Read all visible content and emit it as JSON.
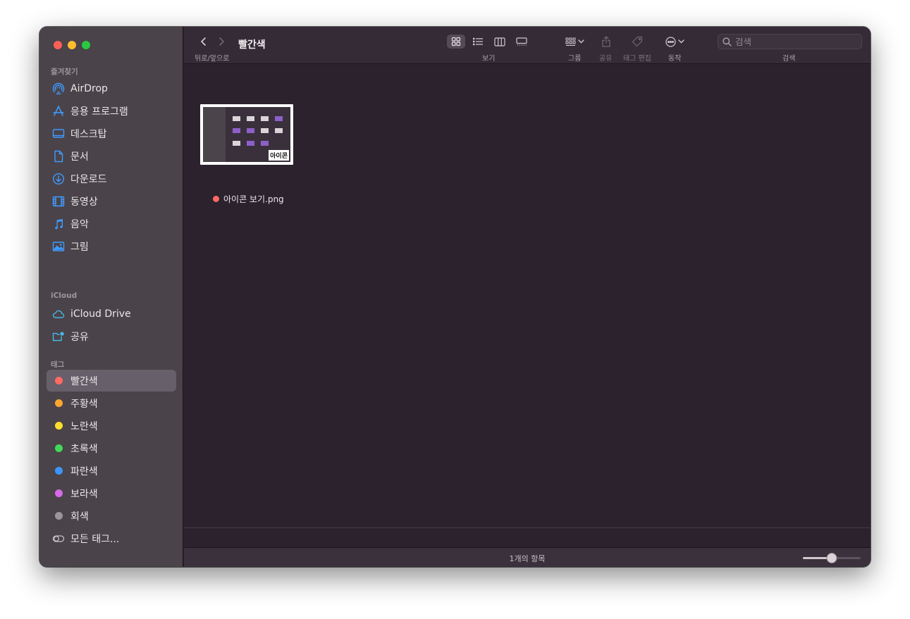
{
  "sidebar": {
    "favorites_title": "즐겨찾기",
    "favorites": [
      {
        "label": "AirDrop",
        "icon": "airdrop-icon"
      },
      {
        "label": "응용 프로그램",
        "icon": "applications-icon"
      },
      {
        "label": "데스크탑",
        "icon": "desktop-icon"
      },
      {
        "label": "문서",
        "icon": "document-icon"
      },
      {
        "label": "다운로드",
        "icon": "download-icon"
      },
      {
        "label": "동영상",
        "icon": "movie-icon"
      },
      {
        "label": "음악",
        "icon": "music-icon"
      },
      {
        "label": "그림",
        "icon": "picture-icon"
      }
    ],
    "icloud_title": "iCloud",
    "icloud": [
      {
        "label": "iCloud Drive",
        "icon": "cloud-icon"
      },
      {
        "label": "공유",
        "icon": "shared-folder-icon"
      }
    ],
    "tags_title": "태그",
    "tags": [
      {
        "label": "빨간색",
        "color": "#ff6a63",
        "active": true
      },
      {
        "label": "주황색",
        "color": "#ffa630"
      },
      {
        "label": "노란색",
        "color": "#ffdf2d"
      },
      {
        "label": "초록색",
        "color": "#41d95a"
      },
      {
        "label": "파란색",
        "color": "#3c95ff"
      },
      {
        "label": "보라색",
        "color": "#d66ae8"
      },
      {
        "label": "회색",
        "color": "#9b969a"
      }
    ],
    "all_tags": "모든 태그..."
  },
  "toolbar": {
    "title": "빨간색",
    "nav_label": "뒤로/앞으로",
    "view_label": "보기",
    "group_label": "그룹",
    "share_label": "공유",
    "tag_edit_label": "태그 편집",
    "action_label": "동작",
    "search_label": "검색",
    "search_placeholder": "검색"
  },
  "files": [
    {
      "name": "아이콘 보기.png",
      "tag_color": "#ff6a63",
      "thumb_badge": "아이콘"
    }
  ],
  "status": {
    "item_count": "1개의 항목",
    "icon_size_fraction": 0.5
  }
}
